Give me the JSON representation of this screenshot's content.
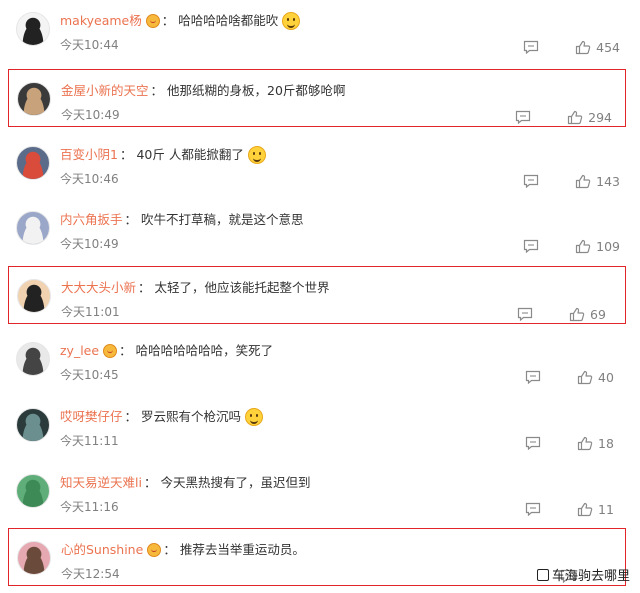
{
  "comments": [
    {
      "user": "makyeame杨",
      "vip": true,
      "text": "哈哈哈哈啥都能吹",
      "emoji": "laugh-emoji",
      "time": "今天10:44",
      "likes": "454",
      "highlighted": false,
      "avatar_color": "#f4f4f4",
      "avatar_accent": "#222222"
    },
    {
      "user": "金屋小新的天空",
      "vip": false,
      "text": "他那纸糊的身板，20斤都够呛啊",
      "emoji": null,
      "time": "今天10:49",
      "likes": "294",
      "highlighted": true,
      "avatar_color": "#3a3a3a",
      "avatar_accent": "#c8a27a"
    },
    {
      "user": "百变小阴1",
      "vip": false,
      "text": "40斤 人都能掀翻了",
      "emoji": "wondering-emoji",
      "time": "今天10:46",
      "likes": "143",
      "highlighted": false,
      "avatar_color": "#5b6b8a",
      "avatar_accent": "#d94b3b"
    },
    {
      "user": "内六角扳手",
      "vip": false,
      "text": "吹牛不打草稿，就是这个意思",
      "emoji": null,
      "time": "今天10:49",
      "likes": "109",
      "highlighted": false,
      "avatar_color": "#9aa7c9",
      "avatar_accent": "#f2f2f2"
    },
    {
      "user": "大大大头小新",
      "vip": false,
      "text": "太轻了，他应该能托起整个世界",
      "emoji": null,
      "time": "今天11:01",
      "likes": "69",
      "highlighted": true,
      "avatar_color": "#f1d2b0",
      "avatar_accent": "#222222"
    },
    {
      "user": "zy_lee",
      "vip": true,
      "text": "哈哈哈哈哈哈哈，笑死了",
      "emoji": null,
      "time": "今天10:45",
      "likes": "40",
      "highlighted": false,
      "avatar_color": "#e9e9e9",
      "avatar_accent": "#444444"
    },
    {
      "user": "哎呀樊仔仔",
      "vip": false,
      "text": "罗云熙有个枪沉吗",
      "emoji": "cry-laugh-emoji",
      "time": "今天11:11",
      "likes": "18",
      "highlighted": false,
      "avatar_color": "#2b3b3b",
      "avatar_accent": "#6b8f8f"
    },
    {
      "user": "知天易逆天难li",
      "vip": false,
      "text": "今天黑热搜有了，虽迟但到",
      "emoji": null,
      "time": "今天11:16",
      "likes": "11",
      "highlighted": false,
      "avatar_color": "#5fae7a",
      "avatar_accent": "#3d8a57"
    },
    {
      "user": "心的Sunshine",
      "vip": true,
      "text": "推荐去当举重运动员。",
      "emoji": null,
      "time": "今天12:54",
      "likes": "",
      "highlighted": true,
      "avatar_color": "#e6a9b2",
      "avatar_accent": "#6a4a3a"
    }
  ],
  "watermark": "车海驹去哪里",
  "colors": {
    "username": "#eb7350",
    "highlight_border": "#e0262b",
    "meta": "#808080",
    "text": "#333333"
  }
}
